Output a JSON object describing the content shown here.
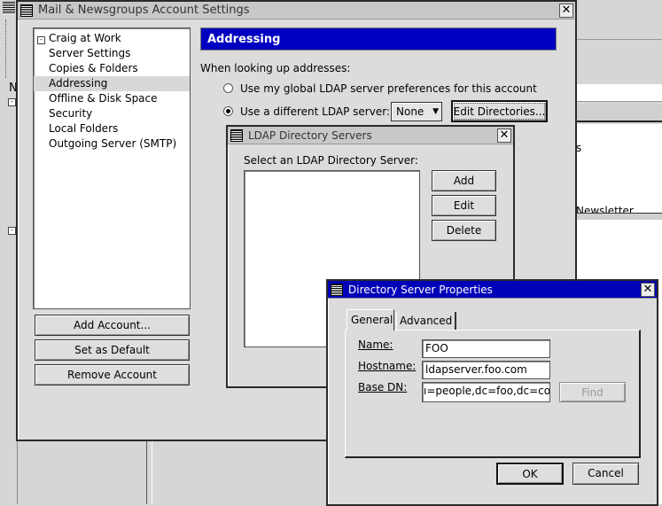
{
  "background": {
    "header_letter": "N",
    "list_fragment": "s",
    "list_item": "Newsletter"
  },
  "main_dialog": {
    "title": "Mail & Newsgroups Account Settings",
    "tree": {
      "account": "Craig at Work",
      "items": [
        "Server Settings",
        "Copies & Folders",
        "Addressing",
        "Offline & Disk Space",
        "Security",
        "Local Folders",
        "Outgoing Server (SMTP)"
      ],
      "selected": "Addressing"
    },
    "buttons": {
      "add_account": "Add Account...",
      "set_default": "Set as Default",
      "remove_account": "Remove Account"
    },
    "panel": {
      "header": "Addressing",
      "prompt": "When looking up addresses:",
      "radio_global": "Use my global LDAP server preferences for this account",
      "radio_different": "Use a different LDAP server:",
      "server_select": "None",
      "edit_directories": "Edit Directories..."
    }
  },
  "ldap_dialog": {
    "title": "LDAP Directory Servers",
    "label": "Select an LDAP Directory Server:",
    "buttons": {
      "add": "Add",
      "edit": "Edit",
      "delete": "Delete"
    }
  },
  "props_dialog": {
    "title": "Directory Server Properties",
    "tabs": [
      "General",
      "Advanced"
    ],
    "active_tab": "General",
    "fields": {
      "name_label": "Name:",
      "name_value": "FOO",
      "hostname_label": "Hostname:",
      "hostname_value": "ldapserver.foo.com",
      "basedn_label": "Base DN:",
      "basedn_value": "ı=people,dc=foo,dc=com"
    },
    "find": "Find",
    "ok": "OK",
    "cancel": "Cancel"
  }
}
